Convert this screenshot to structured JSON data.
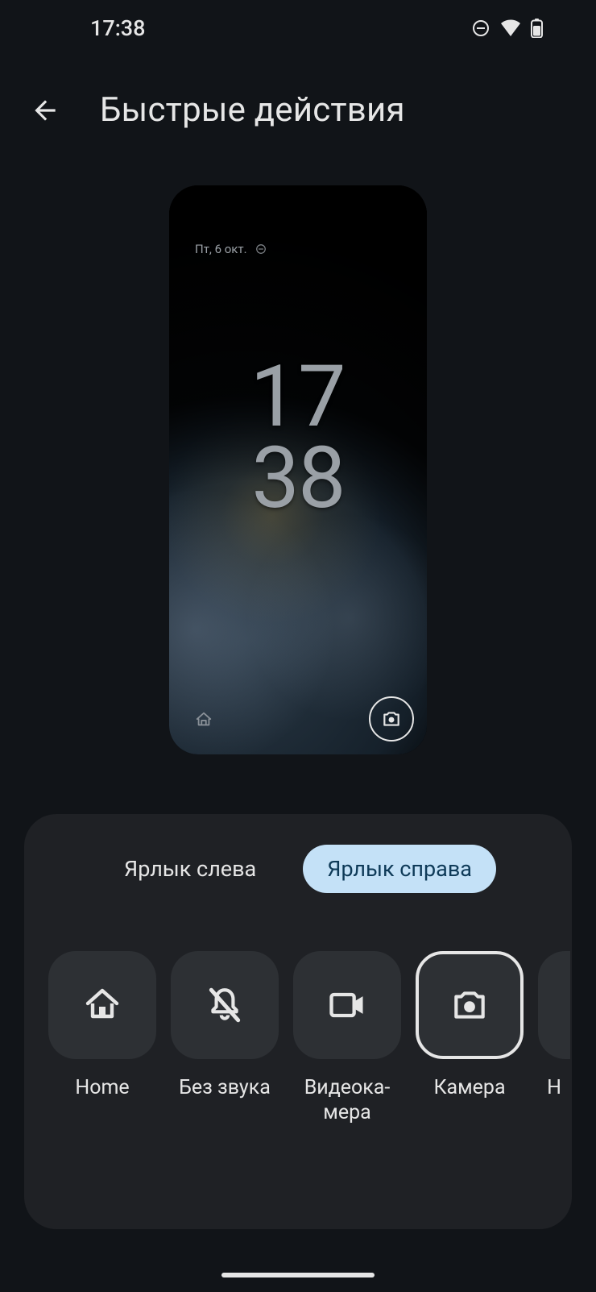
{
  "status": {
    "time": "17:38"
  },
  "header": {
    "title": "Быстрые действия"
  },
  "preview": {
    "date": "Пт, 6 окт.",
    "clock_top": "17",
    "clock_bottom": "38",
    "left_icon": "home-icon",
    "right_icon": "camera-icon"
  },
  "sheet": {
    "tabs": {
      "left": "Ярлык слева",
      "right": "Ярлык справа",
      "active": "right"
    },
    "shortcuts": [
      {
        "id": "home",
        "label": "Home",
        "icon": "home-icon",
        "selected": false
      },
      {
        "id": "mute",
        "label": "Без звука",
        "icon": "bell-off-icon",
        "selected": false
      },
      {
        "id": "video",
        "label": "Видеока­мера",
        "icon": "videocam-icon",
        "selected": false
      },
      {
        "id": "camera",
        "label": "Камера",
        "icon": "camera-icon",
        "selected": true
      },
      {
        "id": "next",
        "label": "Н",
        "icon": "",
        "selected": false
      }
    ]
  },
  "colors": {
    "bg": "#111418",
    "sheet": "#1f2125",
    "tile": "#2d3034",
    "tab_active_bg": "#c4e1f7",
    "tab_active_fg": "#0e3a58",
    "fg": "#e6e6e6",
    "sub": "#9aa0a6"
  }
}
